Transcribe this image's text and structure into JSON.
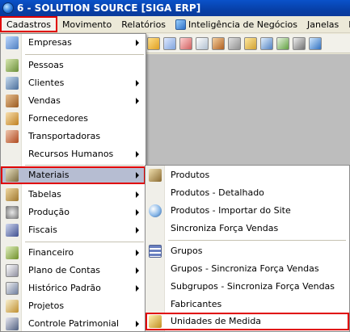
{
  "window": {
    "title": "6 - SOLUTION SOURCE [SIGA ERP]"
  },
  "menubar": {
    "items": [
      "Cadastros",
      "Movimento",
      "Relatórios",
      "Inteligência de Negócios",
      "Janelas",
      "H"
    ]
  },
  "menu": {
    "items": [
      {
        "label": "Empresas",
        "icon": "building-icon",
        "has_submenu": true
      },
      {
        "label": "Pessoas",
        "icon": "people-icon",
        "has_submenu": false
      },
      {
        "label": "Clientes",
        "icon": "clients-icon",
        "has_submenu": true
      },
      {
        "label": "Vendas",
        "icon": "briefcase-icon",
        "has_submenu": true
      },
      {
        "label": "Fornecedores",
        "icon": "supplier-icon",
        "has_submenu": false
      },
      {
        "label": "Transportadoras",
        "icon": "truck-icon",
        "has_submenu": false
      },
      {
        "label": "Recursos Humanos",
        "icon": "",
        "has_submenu": true
      },
      {
        "label": "Materiais",
        "icon": "materials-icon",
        "has_submenu": true
      },
      {
        "label": "Tabelas",
        "icon": "tables-icon",
        "has_submenu": true
      },
      {
        "label": "Produção",
        "icon": "gears-icon",
        "has_submenu": true
      },
      {
        "label": "Fiscais",
        "icon": "fiscal-icon",
        "has_submenu": true
      },
      {
        "label": "Financeiro",
        "icon": "money-icon",
        "has_submenu": true
      },
      {
        "label": "Plano de Contas",
        "icon": "accounts-icon",
        "has_submenu": true
      },
      {
        "label": "Histórico Padrão",
        "icon": "history-icon",
        "has_submenu": true
      },
      {
        "label": "Projetos",
        "icon": "projects-icon",
        "has_submenu": false
      },
      {
        "label": "Controle Patrimonial",
        "icon": "asset-icon",
        "has_submenu": true
      }
    ]
  },
  "submenu": {
    "items": [
      {
        "label": "Produtos",
        "icon": "product-icon"
      },
      {
        "label": "Produtos - Detalhado",
        "icon": ""
      },
      {
        "label": "Produtos - Importar do Site",
        "icon": "globe-icon"
      },
      {
        "label": "Sincroniza Força Vendas",
        "icon": ""
      },
      {
        "label": "Grupos",
        "icon": "groups-icon"
      },
      {
        "label": "Grupos - Sincroniza Força Vendas",
        "icon": ""
      },
      {
        "label": "Subgrupos - Sincroniza Força Vendas",
        "icon": ""
      },
      {
        "label": "Fabricantes",
        "icon": ""
      },
      {
        "label": "Unidades de Medida",
        "icon": "scale-icon"
      }
    ]
  },
  "colors": {
    "highlight_border": "#e00000",
    "selected_bg": "#b6bdd2",
    "titlebar": "#0a52c9"
  }
}
